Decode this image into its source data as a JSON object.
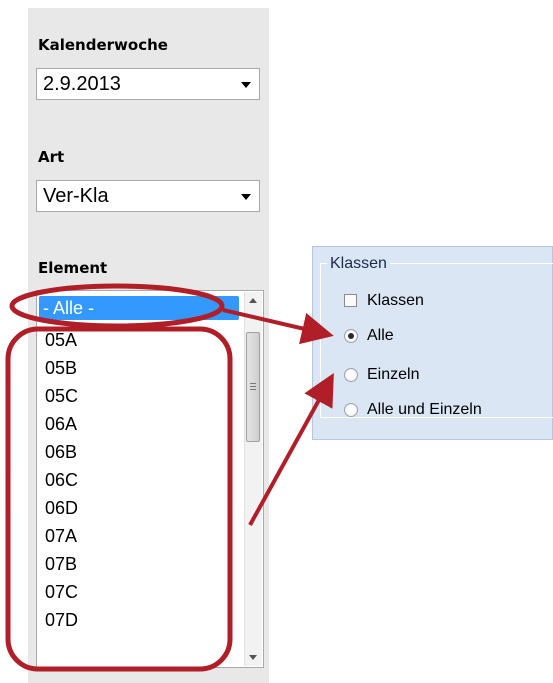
{
  "sidebar": {
    "week_label": "Kalenderwoche",
    "week_value": "2.9.2013",
    "type_label": "Art",
    "type_value": "Ver-Kla",
    "element_label": "Element",
    "element_items": [
      "- Alle -",
      "05A",
      "05B",
      "05C",
      "06A",
      "06B",
      "06C",
      "06D",
      "07A",
      "07B",
      "07C",
      "07D"
    ]
  },
  "klassen_group": {
    "title": "Klassen",
    "checkbox_label": "Klassen",
    "checkbox_checked": false,
    "options": [
      "Alle",
      "Einzeln",
      "Alle und Einzeln"
    ],
    "selected_option": "Alle"
  },
  "colors": {
    "panel_bg": "#e8e8e8",
    "selection": "#3399ff",
    "group_bg": "#dbe6f4",
    "annotation": "#b01e28"
  }
}
